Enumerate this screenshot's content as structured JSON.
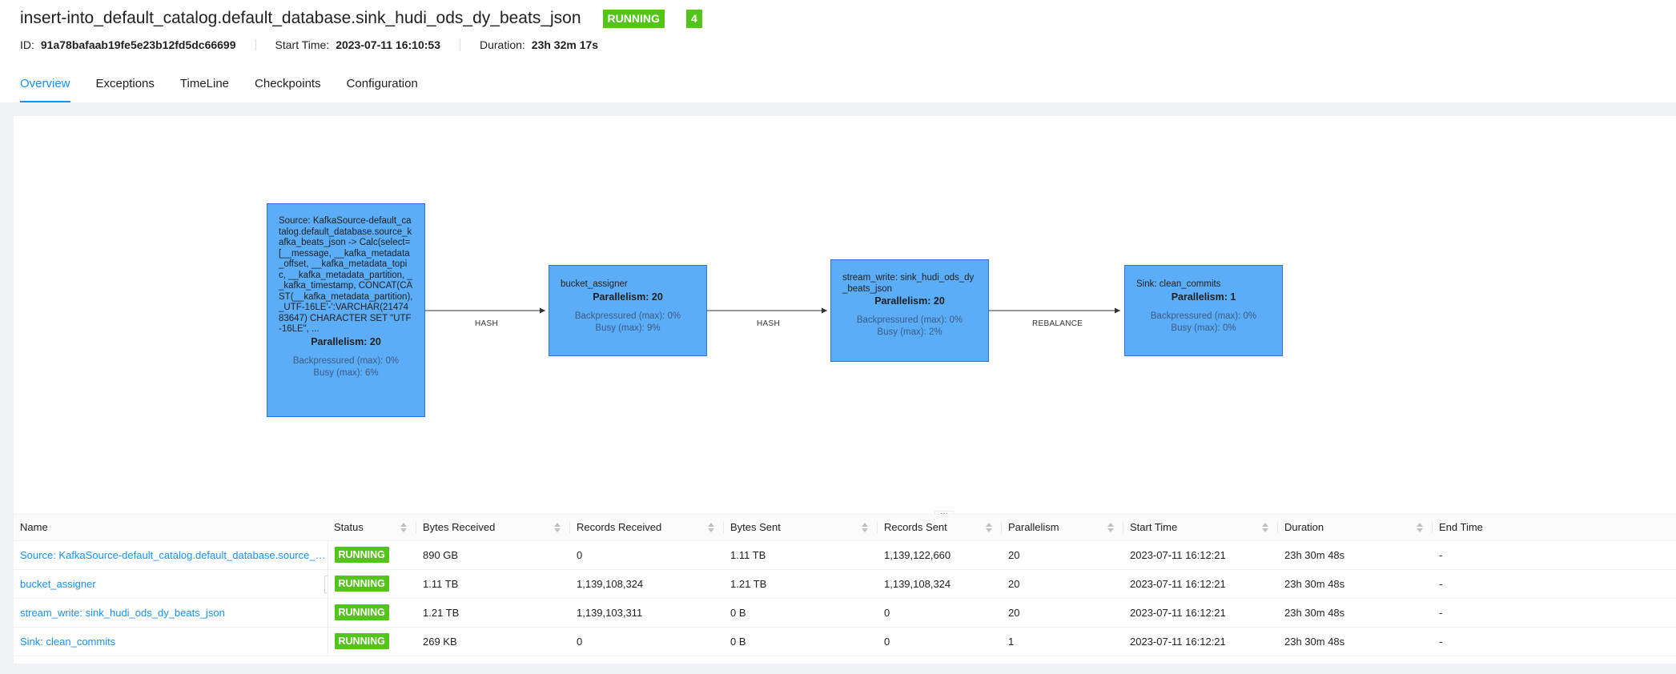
{
  "job": {
    "title": "insert-into_default_catalog.default_database.sink_hudi_ods_dy_beats_json",
    "status": "RUNNING",
    "task_count": "4",
    "id_label": "ID:",
    "id_value": "91a78bafaab19fe5e23b12fd5dc66699",
    "start_label": "Start Time:",
    "start_value": "2023-07-11 16:10:53",
    "duration_label": "Duration:",
    "duration_value": "23h 32m 17s"
  },
  "tabs": [
    "Overview",
    "Exceptions",
    "TimeLine",
    "Checkpoints",
    "Configuration"
  ],
  "graph": {
    "nodes": [
      {
        "name": "Source: KafkaSource-default_catalog.default_database.source_kafka_beats_json -> Calc(select=[__message, __kafka_metadata_offset, __kafka_metadata_topic, __kafka_metadata_partition, __kafka_timestamp, CONCAT(CAST(__kafka_metadata_partition), _UTF-16LE'-':VARCHAR(2147483647) CHARACTER SET \"UTF-16LE\", ...",
        "parallelism": "Parallelism: 20",
        "backpressured": "Backpressured (max): 0%",
        "busy": "Busy (max): 6%"
      },
      {
        "name": "bucket_assigner",
        "parallelism": "Parallelism: 20",
        "backpressured": "Backpressured (max): 0%",
        "busy": "Busy (max): 9%"
      },
      {
        "name": "stream_write: sink_hudi_ods_dy_beats_json",
        "parallelism": "Parallelism: 20",
        "backpressured": "Backpressured (max): 0%",
        "busy": "Busy (max): 2%"
      },
      {
        "name": "Sink: clean_commits",
        "parallelism": "Parallelism: 1",
        "backpressured": "Backpressured (max): 0%",
        "busy": "Busy (max): 0%"
      }
    ],
    "edges": [
      "HASH",
      "HASH",
      "REBALANCE"
    ],
    "resize_glyph": "···"
  },
  "table": {
    "headers": [
      "Name",
      "Status",
      "Bytes Received",
      "Records Received",
      "Bytes Sent",
      "Records Sent",
      "Parallelism",
      "Start Time",
      "Duration",
      "End Time"
    ],
    "rows": [
      [
        "Source: KafkaSource-default_catalog.default_database.source_kafka_beats_json -> ...",
        "RUNNING",
        "890 GB",
        "0",
        "1.11 TB",
        "1,139,122,660",
        "20",
        "2023-07-11 16:12:21",
        "23h 30m 48s",
        "-"
      ],
      [
        "bucket_assigner",
        "RUNNING",
        "1.11 TB",
        "1,139,108,324",
        "1.21 TB",
        "1,139,108,324",
        "20",
        "2023-07-11 16:12:21",
        "23h 30m 48s",
        "-"
      ],
      [
        "stream_write: sink_hudi_ods_dy_beats_json",
        "RUNNING",
        "1.21 TB",
        "1,139,103,311",
        "0 B",
        "0",
        "20",
        "2023-07-11 16:12:21",
        "23h 30m 48s",
        "-"
      ],
      [
        "Sink: clean_commits",
        "RUNNING",
        "269 KB",
        "0",
        "0 B",
        "0",
        "1",
        "2023-07-11 16:12:21",
        "23h 30m 48s",
        "-"
      ]
    ],
    "drag_glyph": "⋮"
  },
  "colors": {
    "accent": "#1890ff",
    "running": "#52c41a",
    "node_fill": "#5badf7"
  }
}
